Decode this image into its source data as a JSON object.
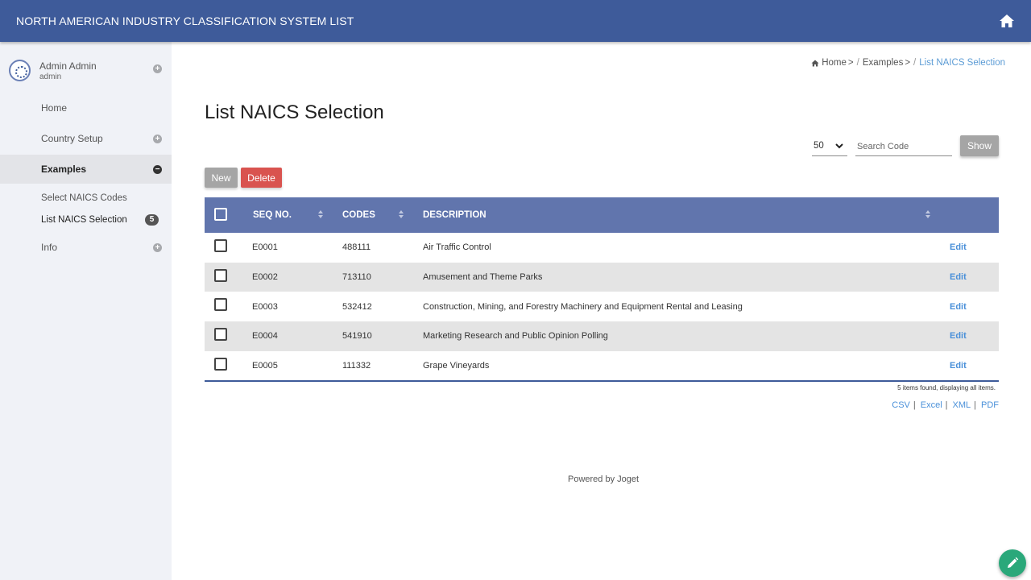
{
  "header": {
    "title": "NORTH AMERICAN INDUSTRY CLASSIFICATION SYSTEM LIST",
    "home_icon": "home-icon"
  },
  "profile": {
    "name": "Admin Admin",
    "role": "admin",
    "expand_icon": "plus"
  },
  "sidebar": {
    "items": [
      {
        "label": "Home"
      },
      {
        "label": "Country Setup",
        "icon": "plus"
      },
      {
        "label": "Examples",
        "icon": "minus"
      },
      {
        "label": "Info",
        "icon": "plus"
      }
    ],
    "sub_items": [
      {
        "label": "Select NAICS Codes"
      },
      {
        "label": "List NAICS Selection",
        "badge": "5"
      }
    ]
  },
  "breadcrumb": {
    "home": "Home",
    "sep1": ">",
    "examples": "Examples",
    "sep2": ">",
    "current": "List NAICS Selection"
  },
  "page": {
    "title": "List NAICS Selection"
  },
  "controls": {
    "page_size": "50",
    "search_placeholder": "Search Code",
    "show_label": "Show",
    "new_label": "New",
    "delete_label": "Delete"
  },
  "table": {
    "columns": [
      "SEQ NO.",
      "CODES",
      "DESCRIPTION"
    ],
    "edit_label": "Edit",
    "rows": [
      {
        "seq": "E0001",
        "code": "488111",
        "desc": "Air Traffic Control"
      },
      {
        "seq": "E0002",
        "code": "713110",
        "desc": "Amusement and Theme Parks"
      },
      {
        "seq": "E0003",
        "code": "532412",
        "desc": "Construction, Mining, and Forestry Machinery and Equipment Rental and Leasing"
      },
      {
        "seq": "E0004",
        "code": "541910",
        "desc": "Marketing Research and Public Opinion Polling"
      },
      {
        "seq": "E0005",
        "code": "111332",
        "desc": "Grape Vineyards"
      }
    ]
  },
  "summary": "5 items found, displaying all items.",
  "exports": [
    "CSV",
    "Excel",
    "XML",
    "PDF"
  ],
  "footer": "Powered by Joget",
  "colors": {
    "header_bg": "#3e5b9a",
    "table_header_bg": "#6175ad",
    "delete_bg": "#d9534f",
    "link": "#4a90d9",
    "fab": "#2aa87a"
  }
}
